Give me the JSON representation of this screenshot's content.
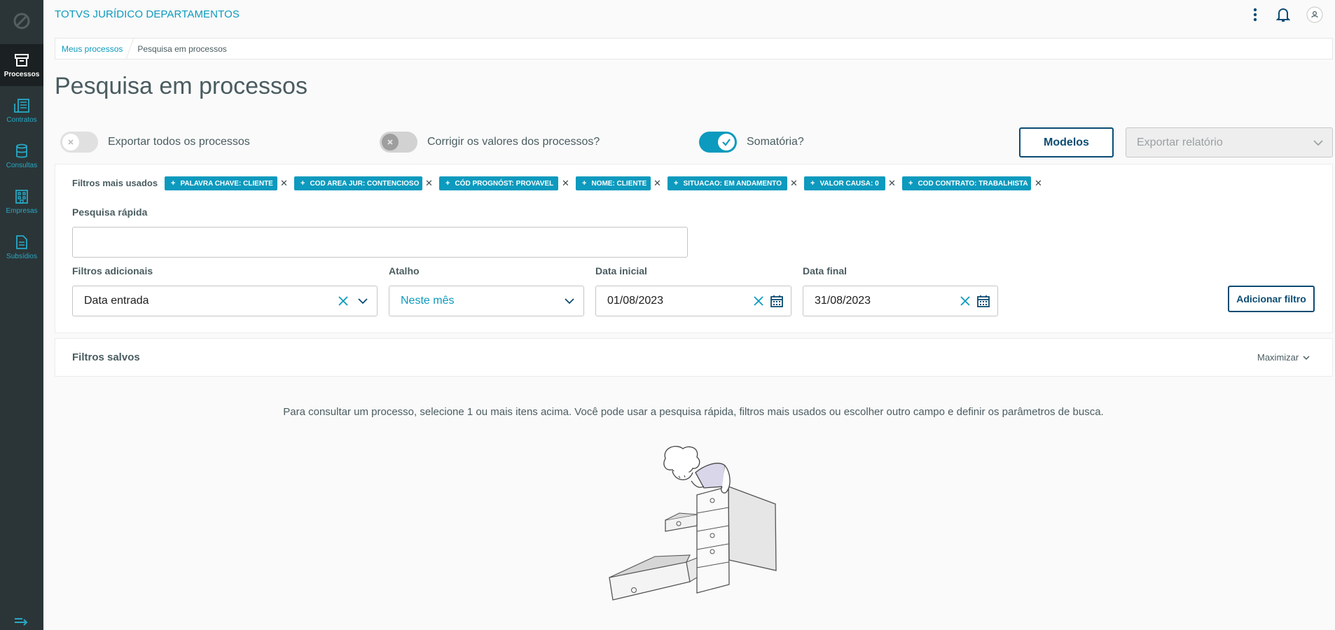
{
  "app": {
    "title": "TOTVS JURÍDICO DEPARTAMENTOS"
  },
  "sidebar": {
    "items": [
      {
        "label": "Processos",
        "icon": "archive-box-icon",
        "active": true
      },
      {
        "label": "Contratos",
        "icon": "contracts-icon",
        "active": false
      },
      {
        "label": "Consultas",
        "icon": "database-icon",
        "active": false
      },
      {
        "label": "Empresas",
        "icon": "building-icon",
        "active": false
      },
      {
        "label": "Subsídios",
        "icon": "document-icon",
        "active": false
      }
    ]
  },
  "breadcrumb": {
    "items": [
      "Meus processos",
      "Pesquisa em processos"
    ]
  },
  "page": {
    "title": "Pesquisa em processos"
  },
  "options": {
    "export_all": {
      "label": "Exportar todos os processos",
      "checked": false
    },
    "correct_values": {
      "label": "Corrigir os valores dos processos?",
      "checked": false
    },
    "sum": {
      "label": "Somatória?",
      "checked": true
    }
  },
  "actions": {
    "models_label": "Modelos",
    "export_placeholder": "Exportar relatório"
  },
  "filters": {
    "most_used_label": "Filtros mais usados",
    "chips": [
      "PALAVRA CHAVE: CLIENTE",
      "COD AREA JUR: CONTENCIOSO",
      "CÓD PROGNÓST: PROVAVEL",
      "NOME: CLIENTE",
      "SITUACAO: EM ANDAMENTO",
      "VALOR CAUSA: 0",
      "COD CONTRATO: TRABALHISTA"
    ],
    "quick_search": {
      "label": "Pesquisa rápida",
      "value": ""
    },
    "additional": {
      "label": "Filtros adicionais",
      "value": "Data entrada"
    },
    "shortcut": {
      "label": "Atalho",
      "value": "Neste mês"
    },
    "start_date": {
      "label": "Data inicial",
      "value": "01/08/2023"
    },
    "end_date": {
      "label": "Data final",
      "value": "31/08/2023"
    },
    "add_filter_label": "Adicionar filtro"
  },
  "saved_filters": {
    "title": "Filtros salvos",
    "toggle_label": "Maximizar"
  },
  "hint": "Para consultar um processo, selecione 1 ou mais itens acima. Você pode usar a pesquisa rápida, filtros mais usados ou escolher outro campo e definir os parâmetros de busca.",
  "colors": {
    "primary": "#0c9abe",
    "dark": "#0b4c73",
    "sidebar": "#2b3537"
  }
}
